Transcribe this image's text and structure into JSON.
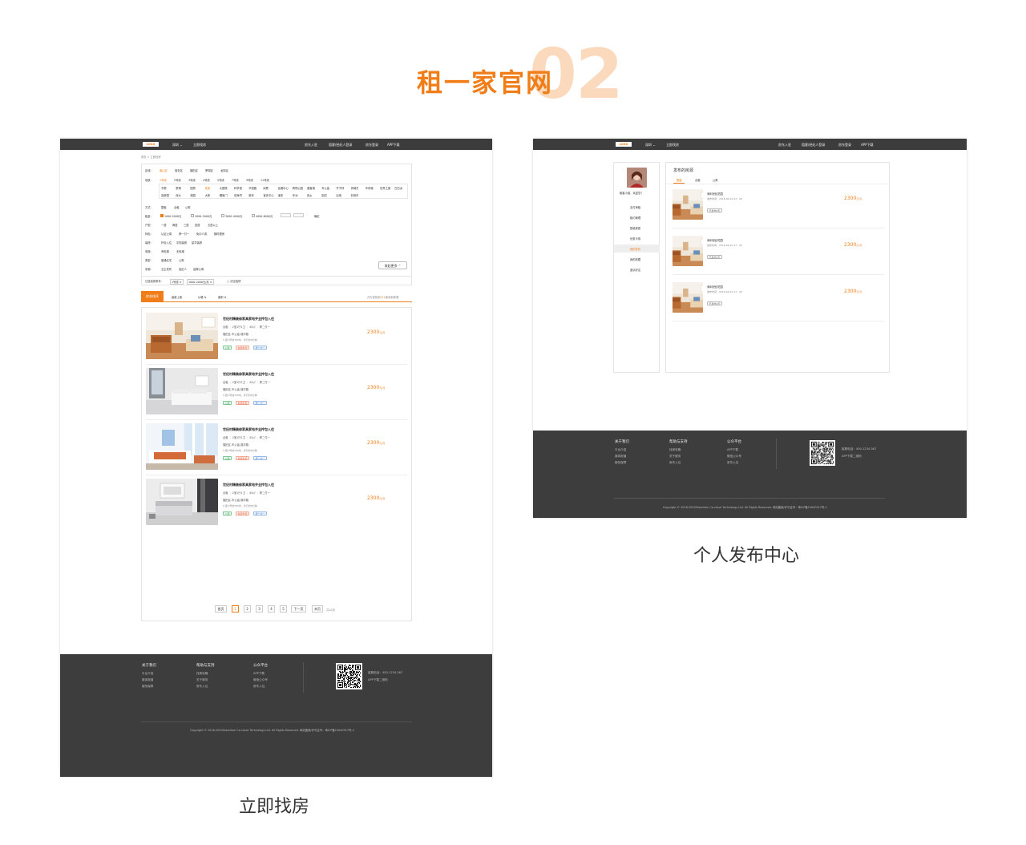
{
  "hero": {
    "title": "租一家官网",
    "number": "02"
  },
  "captions": {
    "left": "立即找房",
    "right": "个人发布中心"
  },
  "colors": {
    "accent": "#f07d18",
    "topbar": "#3c3c3c",
    "footer": "#3d3d3d"
  },
  "topbar": {
    "logo": "LOGO",
    "city": "深圳",
    "city_chevron": "⌄",
    "find_link": "立即找房",
    "nav": [
      "房东入驻",
      "租客/经纪人登录",
      "房东登录",
      "APP下载"
    ]
  },
  "search_page": {
    "breadcrumb": "首页 > 立即找房",
    "filters": {
      "area_label": "区域：",
      "areas": [
        "南山区",
        "宝安区",
        "福田区",
        "罗湖区",
        "龙岗区"
      ],
      "metro_label": "地铁：",
      "metro_lines": [
        "1号线",
        "2号线",
        "3号线",
        "4号线",
        "5号线",
        "7号线",
        "9号线",
        "11号线"
      ],
      "stations": [
        [
          "不限",
          "罗湖",
          "国贸",
          "老街",
          "大剧院",
          "科学馆",
          "华强路",
          "岗厦",
          "会展中心",
          "购物公园",
          "香蜜湖",
          "车公庙",
          "竹子林",
          "侨城东",
          "华侨城",
          "世界之窗",
          "白石洲"
        ],
        [
          "高新园",
          "深大",
          "桃园",
          "大新",
          "鲤鱼门",
          "前海湾",
          "新安",
          "宝安中心",
          "宝体",
          "坪洲",
          "西乡",
          "固戍",
          "后瑞",
          "机场东"
        ]
      ],
      "mode_label": "方式：",
      "modes": [
        "整租",
        "合租",
        "公寓"
      ],
      "rent_label": "租金：",
      "rents": [
        "1000-2000元",
        "2000-3000元",
        "3000-4000元",
        "4000-6000元"
      ],
      "rent_confirm": "确定",
      "layout_label": "户型：",
      "layouts": [
        "一居",
        "两居",
        "三居",
        "四居",
        "五居以上"
      ],
      "feature_label": "特色：",
      "features": [
        "认证公寓",
        "押一付一",
        "免中介费",
        "随时看房"
      ],
      "decor_label": "装修：",
      "decors": [
        "拎包入住",
        "中档装修",
        "豪华装修"
      ],
      "elevator_label": "电梯：",
      "elevators": [
        "有电梯",
        "无电梯"
      ],
      "type_label": "类型：",
      "types": [
        "普通住宅",
        "公寓"
      ],
      "source_label": "来源：",
      "sources": [
        "业主发布",
        "经纪人",
        "品牌公寓"
      ],
      "collapse_btn": "收起更多",
      "selected_label": "已选找房条件：",
      "selected": [
        "1号线",
        "1000-2000元/月"
      ],
      "clear_btn": "清空选项"
    },
    "sort": {
      "tabs": [
        "综合排序",
        "最新上架",
        "价格",
        "面积"
      ],
      "count_prefix": "共为您找到",
      "count": "211",
      "count_suffix": "套深圳房源"
    },
    "listings": [
      {
        "title": "世纪村精装修家具家电齐全拎包入住",
        "mode": "合租",
        "layout": "2室1厅1卫",
        "size": "45㎡",
        "floor": "押二付一",
        "location": "福田区-车公庙-福华路",
        "metro": "距1号线780米，步行约8分钟",
        "tags": [
          "公寓",
          "免服务费",
          "押一付一"
        ],
        "price": "2300",
        "unit": "元/月",
        "img": "wood"
      },
      {
        "title": "世纪村精装修家具家电齐全拎包入住",
        "mode": "合租",
        "layout": "2室1厅1卫",
        "size": "45㎡",
        "floor": "押二付一",
        "location": "福田区-车公庙-福华路",
        "metro": "距1号线780米，步行约8分钟",
        "tags": [
          "公寓",
          "免服务费",
          "押一付一"
        ],
        "price": "2300",
        "unit": "元/月",
        "img": "white"
      },
      {
        "title": "世纪村精装修家具家电齐全拎包入住",
        "mode": "合租",
        "layout": "2室1厅1卫",
        "size": "45㎡",
        "floor": "押二付一",
        "location": "福田区-车公庙-福华路",
        "metro": "距1号线780米，步行约8分钟",
        "tags": [
          "公寓",
          "免服务费",
          "押一付一"
        ],
        "price": "2300",
        "unit": "元/月",
        "img": "bright"
      },
      {
        "title": "世纪村精装修家具家电齐全拎包入住",
        "mode": "合租",
        "layout": "2室1厅1卫",
        "size": "45㎡",
        "floor": "押二付一",
        "location": "福田区-车公庙-福华路",
        "metro": "距1号线780米，步行约8分钟",
        "tags": [
          "公寓",
          "免服务费",
          "押一付一"
        ],
        "price": "2300",
        "unit": "元/月",
        "img": "gray"
      }
    ],
    "pagination": {
      "first": "首页",
      "pages": [
        "1",
        "2",
        "3",
        "4",
        "5"
      ],
      "current": "1",
      "next": "下一页",
      "last": "末页",
      "total": "共10页"
    }
  },
  "footer": {
    "cols": [
      {
        "title": "关于我们",
        "items": [
          "平台介绍",
          "媒体报道",
          "服务保障"
        ]
      },
      {
        "title": "帮助与支持",
        "items": [
          "找房攻略",
          "关于服务",
          "房东入住"
        ]
      },
      {
        "title": "公众平台",
        "items": [
          "APP下载",
          "微信公众号",
          "房东入住"
        ]
      }
    ],
    "phone": "客服电话：400-1234-567",
    "app": "APP下载二维码",
    "copyright": "Copyright © 2018-2020Shenzhen Co-cloud Technology Ltd. All Rights Reserved. 网站备案/许可证号：粤ICP备15040917号-2"
  },
  "publish_page": {
    "user_greeting": "租客小组，欢迎您！",
    "menu": [
      "支付房租",
      "租约管理",
      "智能家居",
      "优惠卡券",
      "我的发布",
      "我的收藏",
      "邀请好友"
    ],
    "active_menu": "我的发布",
    "title": "发布的房源",
    "tabs": [
      "整租",
      "合租",
      "公寓"
    ],
    "active_tab": "整租",
    "items": [
      {
        "name": "深圳世纪花园",
        "time": "发布时间：2018-06-19  23：00",
        "price": "2300",
        "unit": "元/月",
        "status": "已发布2天"
      },
      {
        "name": "深圳世纪花园",
        "time": "发布时间：2018-06-19  17：00",
        "price": "2300",
        "unit": "元/月",
        "status": "已发布2天"
      },
      {
        "name": "深圳世纪花园",
        "time": "发布时间：2018-06-19  17：00",
        "price": "2300",
        "unit": "元/月",
        "status": "已发布2天"
      }
    ]
  }
}
